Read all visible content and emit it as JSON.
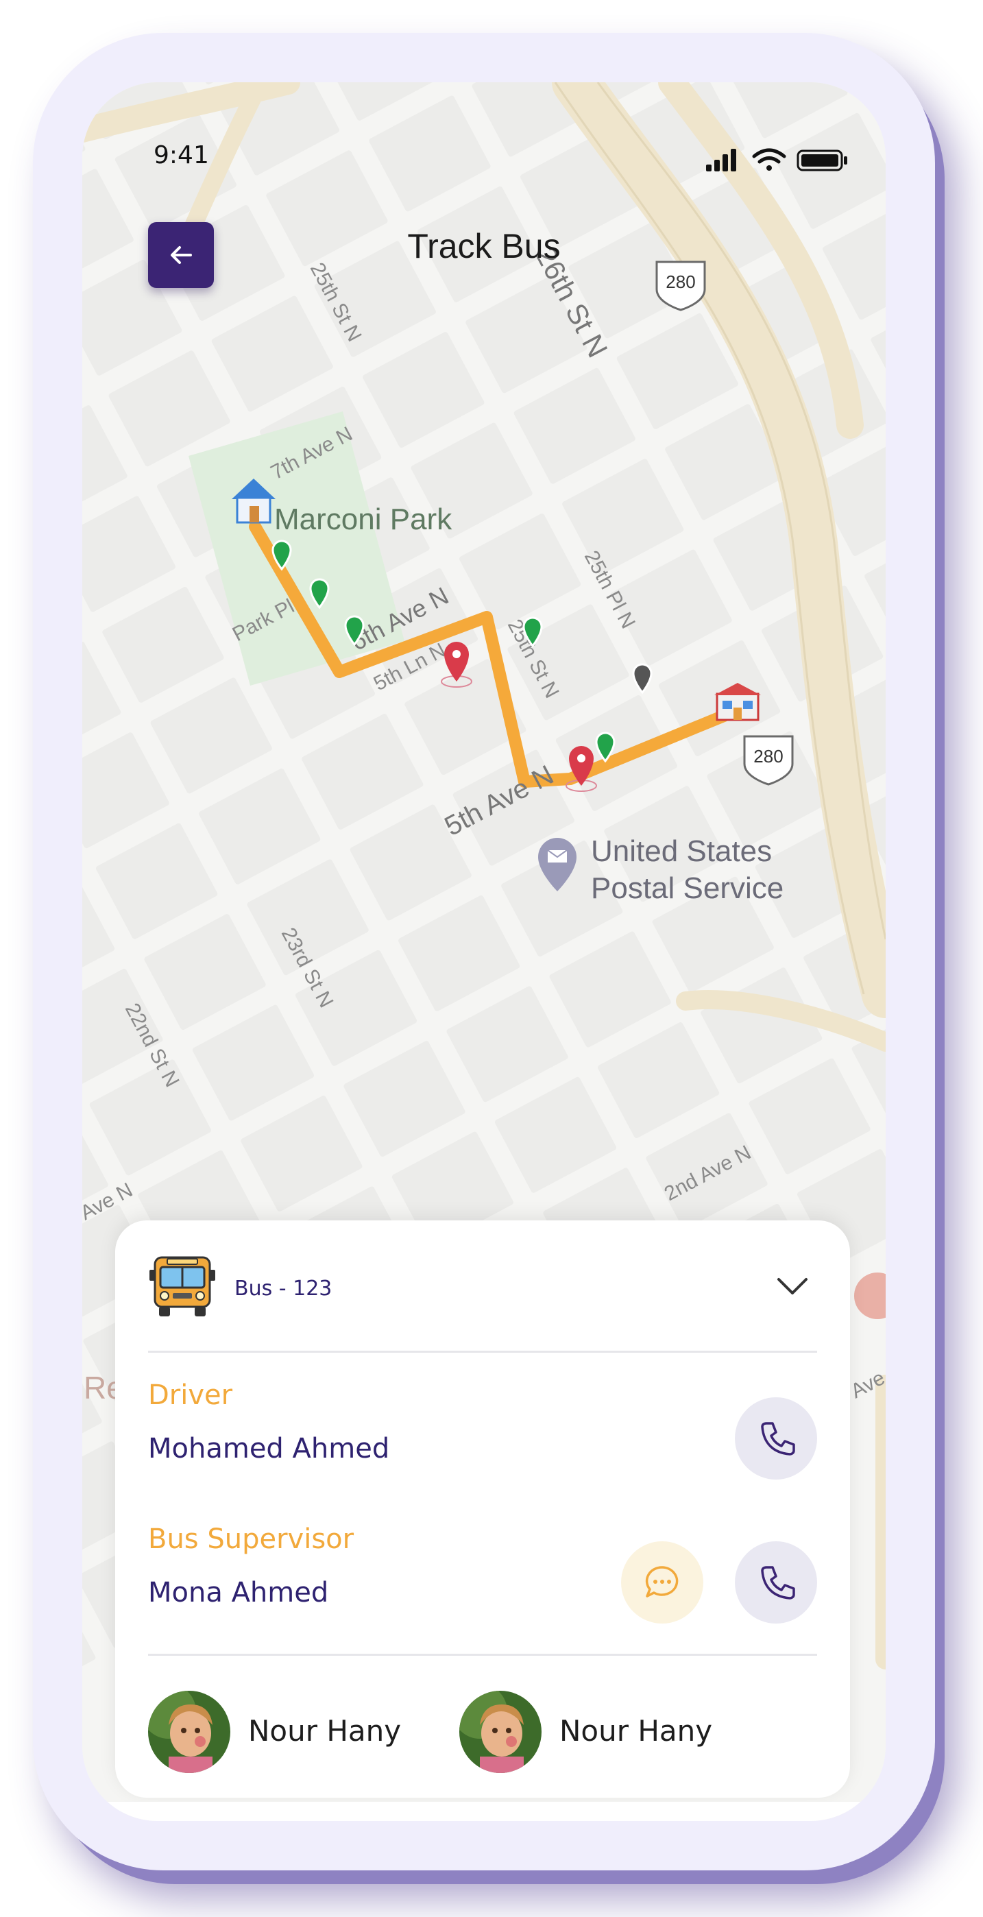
{
  "status_bar": {
    "time": "9:41"
  },
  "header": {
    "title": "Track Bus",
    "back_icon": "arrow-left-icon"
  },
  "map": {
    "street_labels": [
      "25th St N",
      "26th St N",
      "7th Ave N",
      "Park Pl",
      "6th Ave N",
      "5th Ln N",
      "25th St N",
      "25th Pl N",
      "5th Ave N",
      "23rd St N",
      "22nd St N",
      "2nd Ave N",
      "Ave N",
      "Ave N",
      "Re"
    ],
    "highway_shields": [
      "280",
      "280"
    ],
    "places": {
      "park": "Marconi Park",
      "post_office_line1": "United States",
      "post_office_line2": "Postal Service"
    },
    "route_color": "#f5a93a",
    "park_color": "#dfeedd"
  },
  "bus_card": {
    "bus_label": "Bus - 123",
    "bus_icon": "school-bus-icon",
    "expand_icon": "chevron-down-icon",
    "driver_role": "Driver",
    "driver_name": "Mohamed Ahmed",
    "supervisor_role": "Bus Supervisor",
    "supervisor_name": "Mona Ahmed",
    "call_icon": "phone-icon",
    "chat_icon": "chat-bubble-icon",
    "children": [
      {
        "name": "Nour Hany"
      },
      {
        "name": "Nour Hany"
      }
    ]
  },
  "colors": {
    "accent": "#3b2474",
    "role_label": "#f2a93b",
    "name_text": "#2e2270"
  }
}
